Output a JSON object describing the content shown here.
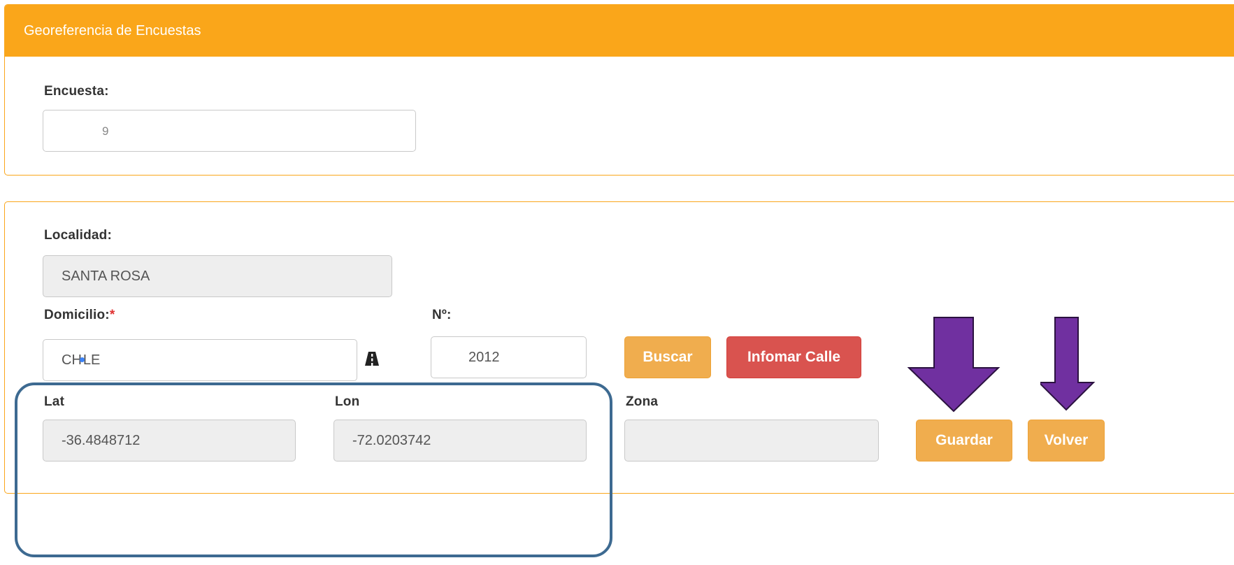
{
  "panel1": {
    "title": "Georeferencia de Encuestas",
    "encuesta_label": "Encuesta:",
    "encuesta_value": "9"
  },
  "panel2": {
    "localidad_label": "Localidad:",
    "localidad_value": "SANTA ROSA",
    "domicilio_label": "Domicilio:",
    "domicilio_required_mark": "*",
    "domicilio_value_before": "CH",
    "domicilio_value_after": "LE",
    "numero_label": "Nº:",
    "numero_value": "2012",
    "buscar_label": "Buscar",
    "informar_calle_label": "Infomar Calle",
    "lat_label": "Lat",
    "lat_value": "-36.4848712",
    "lon_label": "Lon",
    "lon_value": "-72.0203742",
    "zona_label": "Zona",
    "zona_value": "",
    "guardar_label": "Guardar",
    "volver_label": "Volver"
  },
  "icons": {
    "road": "road-icon",
    "arrows": "arrow-down-icon"
  },
  "colors": {
    "header": "#faa61a",
    "warning_button": "#f0ad4e",
    "danger_button": "#d9534f",
    "annotation_arrow": "#7030a0",
    "annotation_box": "#3d6a91",
    "readonly_field": "#eeeeee"
  }
}
